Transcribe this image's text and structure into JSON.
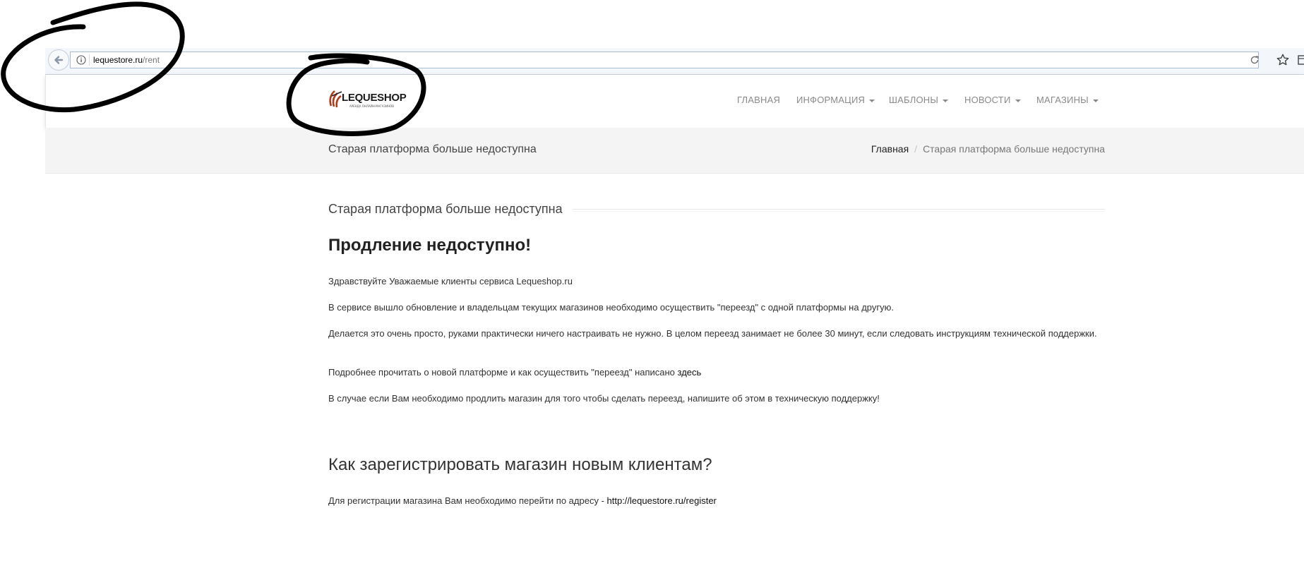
{
  "browser": {
    "url_host": "lequestore.ru",
    "url_path": "/rent"
  },
  "site": {
    "logo_text": "LEQUESHOP",
    "logo_tagline": "АРЕНДА ОНЛАЙН-МАГАЗИНОВ",
    "brand_color": "#b03a1a",
    "nav": [
      {
        "label": "ГЛАВНАЯ",
        "has_dropdown": false
      },
      {
        "label": "ИНФОРМАЦИЯ",
        "has_dropdown": true
      },
      {
        "label": "ШАБЛОНЫ",
        "has_dropdown": true
      },
      {
        "label": "НОВОСТИ",
        "has_dropdown": true
      },
      {
        "label": "МАГАЗИНЫ",
        "has_dropdown": true
      }
    ]
  },
  "page": {
    "band_title": "Старая платформа больше недоступна",
    "breadcrumb": {
      "home": "Главная",
      "separator": "/",
      "current": "Старая платформа больше недоступна"
    }
  },
  "content": {
    "section_heading": "Старая платформа больше недоступна",
    "headline": "Продление недоступно!",
    "p1": "Здравствуйте Уважаемые клиенты сервиса Lequeshop.ru",
    "p2": "В сервисе вышло обновление и владельцам текущих магазинов необходимо осуществить \"переезд\" с одной платформы на другую.",
    "p3": "Делается это очень просто, руками практически ничего настраивать не нужно. В целом переезд занимает не более 30 минут, если следовать инструкциям технической поддержки.",
    "p4_text": "Подробнее прочитать о новой платформе и как осуществить \"переезд\" написано ",
    "p4_link": "здесь",
    "p5": "В случае если Вам необходимо продлить магазин для того чтобы сделать переезд, напишите об этом в техническую поддержку!",
    "h2": "Как зарегистрировать магазин новым клиентам?",
    "p6_text": "Для регистрации магазина Вам необходимо перейти по адресу - ",
    "p6_link": "http://lequestore.ru/register"
  }
}
